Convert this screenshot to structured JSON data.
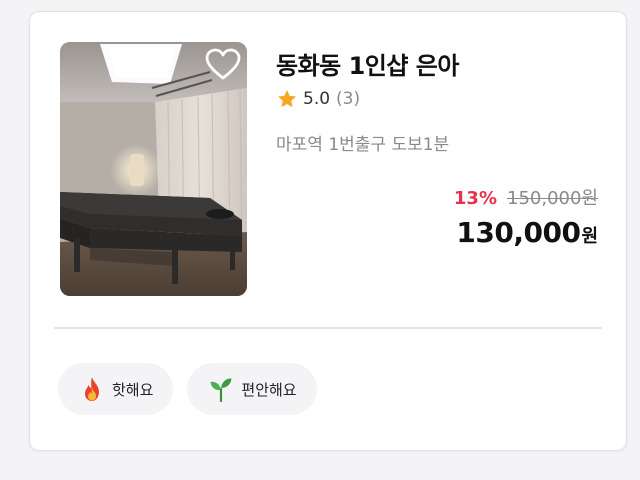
{
  "listing": {
    "title": "동화동 1인샵 은아",
    "rating": {
      "value": "5.0",
      "count": "(3)",
      "icon": "star-icon",
      "star_color": "#f5a623"
    },
    "location": "마포역 1번출구 도보1분",
    "price": {
      "discount": "13%",
      "original": "150,000원",
      "final": "130,000",
      "unit": "원",
      "discount_color": "#e8324d"
    },
    "favorite_icon": "heart-icon",
    "image_icon": "massage-room-photo"
  },
  "tags": [
    {
      "label": "핫해요",
      "icon": "fire-icon"
    },
    {
      "label": "편안해요",
      "icon": "sprout-icon"
    }
  ]
}
